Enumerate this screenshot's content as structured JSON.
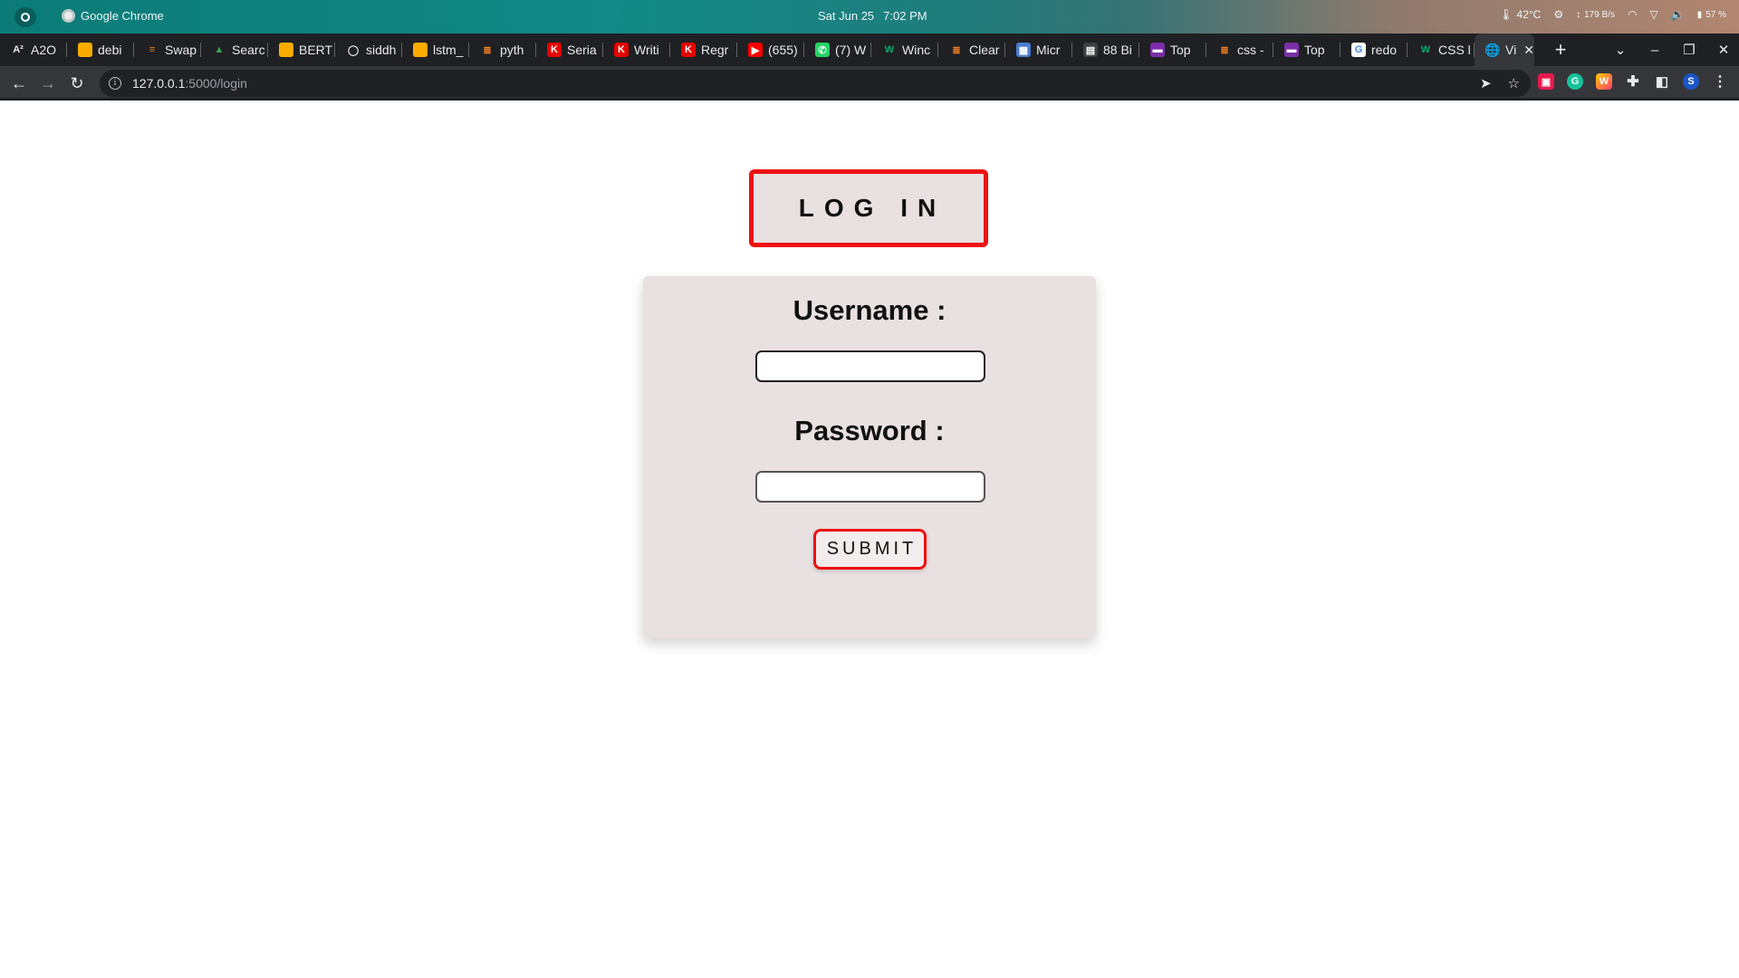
{
  "os": {
    "app_name": "Google Chrome",
    "date": "Sat Jun 25",
    "time": "7:02 PM",
    "temperature": "42°C",
    "network_speed": "179 B/s",
    "battery": "57 %"
  },
  "browser": {
    "tabs": [
      {
        "title": "A2O",
        "favicon": "a2o-icon",
        "color": "#1f2023"
      },
      {
        "title": "debi",
        "favicon": "colab-icon",
        "color": "#f9ab00"
      },
      {
        "title": "Swap",
        "favicon": "stackexchange-icon",
        "color": "#1f2023"
      },
      {
        "title": "Searc",
        "favicon": "google-drive-icon",
        "color": "#1f2023"
      },
      {
        "title": "BERT",
        "favicon": "colab-icon",
        "color": "#f9ab00"
      },
      {
        "title": "siddh",
        "favicon": "github-icon",
        "color": "#1f2023"
      },
      {
        "title": "lstm_",
        "favicon": "colab-icon",
        "color": "#f9ab00"
      },
      {
        "title": "pyth",
        "favicon": "stackoverflow-icon",
        "color": "#1f2023"
      },
      {
        "title": "Seria",
        "favicon": "kaggle-k-icon",
        "color": "#e60000"
      },
      {
        "title": "Writi",
        "favicon": "kaggle-k-icon",
        "color": "#e60000"
      },
      {
        "title": "Regr",
        "favicon": "kaggle-k-icon",
        "color": "#e60000"
      },
      {
        "title": "(655)",
        "favicon": "youtube-icon",
        "color": "#ff0000"
      },
      {
        "title": "(7) W",
        "favicon": "whatsapp-icon",
        "color": "#25d366"
      },
      {
        "title": "Winc",
        "favicon": "w3schools-icon",
        "color": "#1f2023"
      },
      {
        "title": "Clear",
        "favicon": "stackoverflow-icon",
        "color": "#1f2023"
      },
      {
        "title": "Micr",
        "favicon": "microsoft-icon",
        "color": "#4a7bd0"
      },
      {
        "title": "88 Bi",
        "favicon": "page-icon",
        "color": "#3c4043"
      },
      {
        "title": "Top",
        "favicon": "codepen-icon",
        "color": "#7b2ea8"
      },
      {
        "title": "css -",
        "favicon": "stackoverflow-icon",
        "color": "#1f2023"
      },
      {
        "title": "Top",
        "favicon": "codepen-icon",
        "color": "#7b2ea8"
      },
      {
        "title": "redo",
        "favicon": "google-icon",
        "color": "#ffffff"
      },
      {
        "title": "CSS l",
        "favicon": "w3schools-icon",
        "color": "#1f2023"
      }
    ],
    "active_tab": {
      "title": "Vi",
      "favicon": "globe-icon"
    },
    "url_host": "127.0.0.1",
    "url_path": ":5000/login"
  },
  "page": {
    "title": "LOG IN",
    "username_label": "Username :",
    "username_value": "",
    "password_label": "Password :",
    "password_value": "",
    "submit_label": "SUBMIT"
  },
  "colors": {
    "accent_border": "#ee1111",
    "card_background": "#e8e0e1"
  }
}
